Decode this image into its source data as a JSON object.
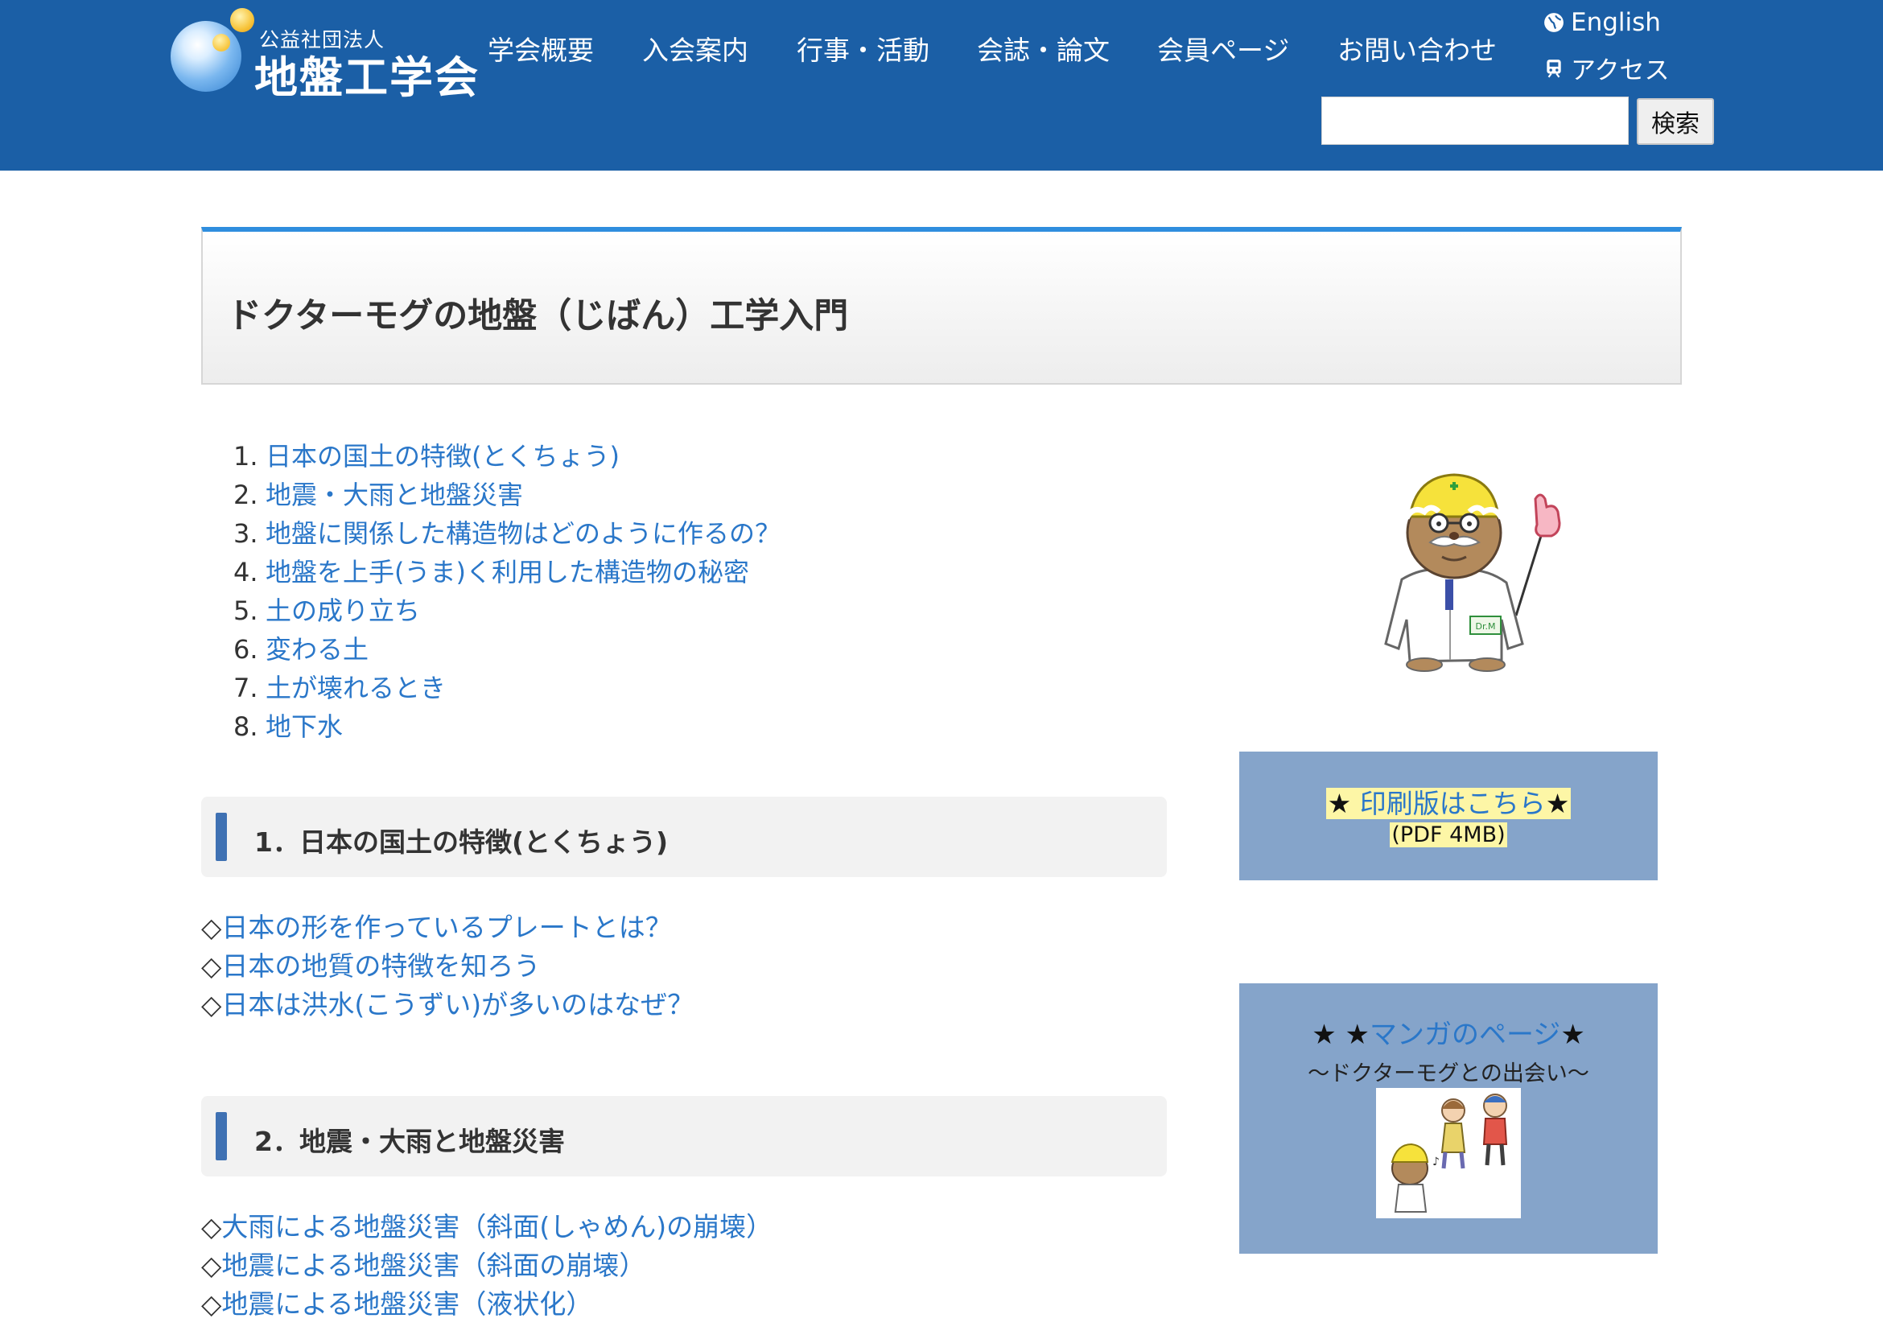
{
  "site": {
    "logo_subtitle": "公益社団法人",
    "logo_title": "地盤工学会"
  },
  "nav": {
    "items": [
      {
        "label": "学会概要"
      },
      {
        "label": "入会案内"
      },
      {
        "label": "行事・活動"
      },
      {
        "label": "会誌・論文"
      },
      {
        "label": "会員ページ"
      },
      {
        "label": "お問い合わせ"
      }
    ],
    "english_label": "English",
    "access_label": "アクセス"
  },
  "search": {
    "value": "",
    "button_label": "検索"
  },
  "page": {
    "title": "ドクターモグの地盤（じばん）工学入門"
  },
  "toc": [
    {
      "num": "1.",
      "label": "日本の国土の特徴(とくちょう)"
    },
    {
      "num": "2.",
      "label": "地震・大雨と地盤災害"
    },
    {
      "num": "3.",
      "label": "地盤に関係した構造物はどのように作るの？"
    },
    {
      "num": "4.",
      "label": "地盤を上手(うま)く利用した構造物の秘密"
    },
    {
      "num": "5.",
      "label": "土の成り立ち"
    },
    {
      "num": "6.",
      "label": "変わる土"
    },
    {
      "num": "7.",
      "label": "土が壊れるとき"
    },
    {
      "num": "8.",
      "label": "地下水"
    }
  ],
  "sections": [
    {
      "title": "1．日本の国土の特徴(とくちょう)",
      "items": [
        {
          "marker": "◇",
          "label": "日本の形を作っているプレートとは？"
        },
        {
          "marker": "◇",
          "label": "日本の地質の特徴を知ろう"
        },
        {
          "marker": "◇",
          "label": "日本は洪水(こうずい)が多いのはなぜ？"
        }
      ]
    },
    {
      "title": "2．地震・大雨と地盤災害",
      "items": [
        {
          "marker": "◇",
          "label": "大雨による地盤災害（斜面(しゃめん)の崩壊）"
        },
        {
          "marker": "◇",
          "label": "地震による地盤災害（斜面の崩壊）"
        },
        {
          "marker": "◇",
          "label": "地震による地盤災害（液状化）"
        }
      ]
    }
  ],
  "sidebar": {
    "mascot_badge": "Dr.M",
    "print": {
      "star_left": "★",
      "link_label": "印刷版はこちら",
      "star_right": "★",
      "size_note": "(PDF 4MB)"
    },
    "manga": {
      "stars_left": "★ ★",
      "link_label": "マンガのページ",
      "star_right": "★",
      "subtitle": "〜ドクターモグとの出会い〜"
    }
  },
  "colors": {
    "header_bg": "#1b5fa6",
    "link": "#2a77c9",
    "title_accent": "#2f8ede",
    "section_bar": "#3f71b3",
    "sidebar_box": "#85a4ca",
    "highlight": "#fdf6a6"
  },
  "icons": {
    "english": "globe-icon",
    "access": "train-icon"
  }
}
